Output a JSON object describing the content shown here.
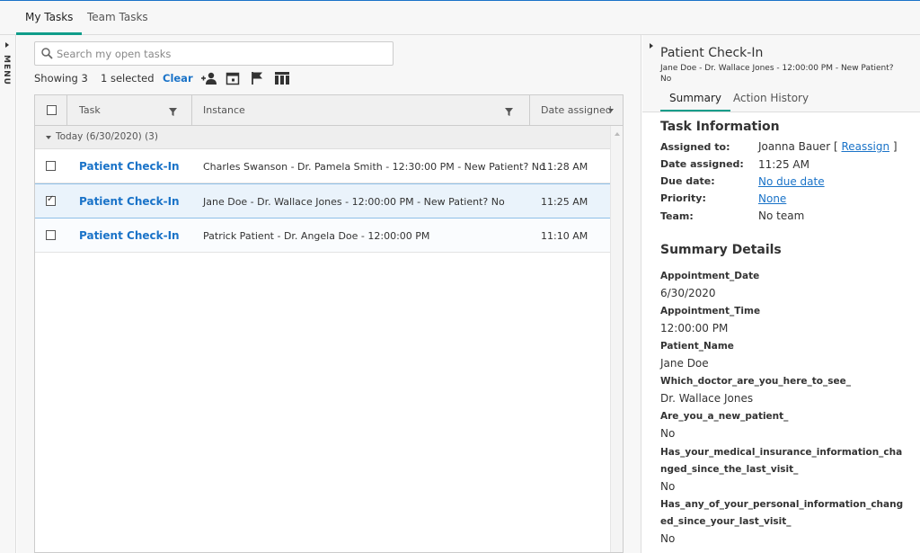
{
  "top_tabs": {
    "my_tasks": "My Tasks",
    "team_tasks": "Team Tasks"
  },
  "menu": {
    "label": "MENU"
  },
  "search": {
    "placeholder": "Search my open tasks",
    "value": ""
  },
  "toolbar": {
    "showing": "Showing 3",
    "selected": "1 selected",
    "clear": "Clear",
    "icons": [
      "assign-user-icon",
      "calendar-icon",
      "flag-icon",
      "columns-icon"
    ]
  },
  "grid": {
    "headers": {
      "task": "Task",
      "instance": "Instance",
      "date_assigned": "Date assigned"
    },
    "group_label": "Today (6/30/2020) (3)",
    "rows": [
      {
        "task": "Patient Check-In",
        "instance": "Charles Swanson - Dr. Pamela Smith - 12:30:00 PM - New Patient? No",
        "date": "11:28 AM",
        "selected": false
      },
      {
        "task": "Patient Check-In",
        "instance": "Jane Doe - Dr. Wallace Jones - 12:00:00 PM - New Patient? No",
        "date": "11:25 AM",
        "selected": true
      },
      {
        "task": "Patient Check-In",
        "instance": "Patrick Patient - Dr. Angela Doe - 12:00:00 PM",
        "date": "11:10 AM",
        "selected": false
      }
    ]
  },
  "detail": {
    "title": "Patient Check-In",
    "subtitle": "Jane Doe - Dr. Wallace Jones - 12:00:00 PM - New Patient? No",
    "tabs": {
      "summary": "Summary",
      "history": "Action History"
    },
    "task_info": {
      "title": "Task Information",
      "assigned_to_label": "Assigned to:",
      "assigned_to_value": "Joanna Bauer",
      "reassign_open": "[",
      "reassign": "Reassign",
      "reassign_close": "]",
      "date_assigned_label": "Date assigned:",
      "date_assigned_value": "11:25 AM",
      "due_date_label": "Due date:",
      "due_date_value": "No due date",
      "priority_label": "Priority:",
      "priority_value": "None",
      "team_label": "Team:",
      "team_value": "No team"
    },
    "summary_details": {
      "title": "Summary Details",
      "fields": [
        {
          "key": "Appointment_Date",
          "value": "6/30/2020"
        },
        {
          "key": "Appointment_Time",
          "value": "12:00:00 PM"
        },
        {
          "key": "Patient_Name",
          "value": "Jane Doe"
        },
        {
          "key": "Which_doctor_are_you_here_to_see_",
          "value": "Dr. Wallace Jones"
        },
        {
          "key": "Are_you_a_new_patient_",
          "value": "No"
        },
        {
          "key": "Has_your_medical_insurance_information_changed_since_the_last_visit_",
          "value": "No"
        },
        {
          "key": "Has_any_of_your_personal_information_changed_since_your_last_visit_",
          "value": "No"
        }
      ]
    }
  },
  "colors": {
    "accent": "#1a73c8",
    "tab_underline": "#0f9d8a",
    "selected_row": "#eaf3fb"
  }
}
